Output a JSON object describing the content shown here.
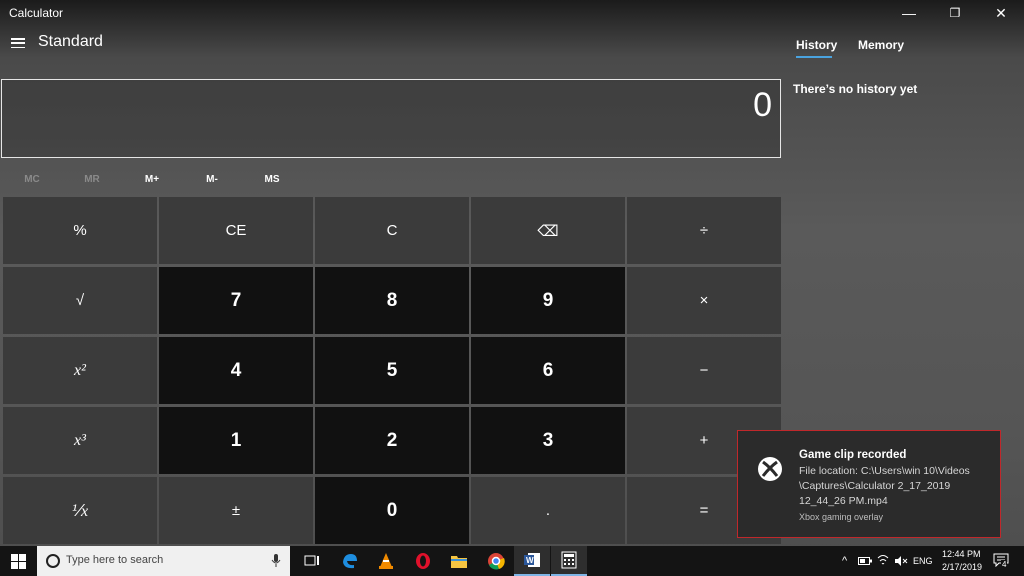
{
  "window": {
    "title": "Calculator",
    "controls": {
      "minimize": "—",
      "maximize": "❐",
      "close": "✕"
    }
  },
  "calculator": {
    "mode": "Standard",
    "display": "0",
    "memory": [
      {
        "label": "MC",
        "enabled": false
      },
      {
        "label": "MR",
        "enabled": false
      },
      {
        "label": "M+",
        "enabled": true
      },
      {
        "label": "M-",
        "enabled": true
      },
      {
        "label": "MS",
        "enabled": true
      }
    ],
    "keys": [
      {
        "label": "%",
        "kind": "op",
        "name": "percent-key"
      },
      {
        "label": "CE",
        "kind": "op",
        "name": "clear-entry-key"
      },
      {
        "label": "C",
        "kind": "op",
        "name": "clear-key"
      },
      {
        "label": "⌫",
        "kind": "op",
        "name": "backspace-key"
      },
      {
        "label": "÷",
        "kind": "op",
        "name": "divide-key"
      },
      {
        "label": "√",
        "kind": "op",
        "name": "square-root-key"
      },
      {
        "label": "7",
        "kind": "digit",
        "name": "digit-7-key"
      },
      {
        "label": "8",
        "kind": "digit",
        "name": "digit-8-key"
      },
      {
        "label": "9",
        "kind": "digit",
        "name": "digit-9-key"
      },
      {
        "label": "×",
        "kind": "op",
        "name": "multiply-key"
      },
      {
        "label": "x²",
        "kind": "italic",
        "name": "square-key"
      },
      {
        "label": "4",
        "kind": "digit",
        "name": "digit-4-key"
      },
      {
        "label": "5",
        "kind": "digit",
        "name": "digit-5-key"
      },
      {
        "label": "6",
        "kind": "digit",
        "name": "digit-6-key"
      },
      {
        "label": "−",
        "kind": "op",
        "name": "subtract-key"
      },
      {
        "label": "x³",
        "kind": "italic",
        "name": "cube-key"
      },
      {
        "label": "1",
        "kind": "digit",
        "name": "digit-1-key"
      },
      {
        "label": "2",
        "kind": "digit",
        "name": "digit-2-key"
      },
      {
        "label": "3",
        "kind": "digit",
        "name": "digit-3-key"
      },
      {
        "label": "+",
        "kind": "op",
        "name": "add-key"
      },
      {
        "label": "⅟x",
        "kind": "italic",
        "name": "reciprocal-key"
      },
      {
        "label": "±",
        "kind": "op",
        "name": "negate-key"
      },
      {
        "label": "0",
        "kind": "digit",
        "name": "digit-0-key"
      },
      {
        "label": ".",
        "kind": "op",
        "name": "decimal-key"
      },
      {
        "label": "=",
        "kind": "op",
        "name": "equals-key"
      }
    ]
  },
  "side_panel": {
    "tabs": [
      "History",
      "Memory"
    ],
    "active_tab": "History",
    "empty_message": "There’s no history yet",
    "accent": "#4aa3df"
  },
  "notification": {
    "title": "Game clip recorded",
    "body": "File location: C:\\Users\\win 10\\Videos \\Captures\\Calculator 2_17_2019 12_44_26 PM.mp4",
    "source": "Xbox gaming overlay",
    "icon": "xbox-icon",
    "border_color": "#c0282b"
  },
  "taskbar": {
    "search_placeholder": "Type here to search",
    "apps": [
      "task-view-icon",
      "edge-icon",
      "vlc-icon",
      "opera-icon",
      "file-explorer-icon",
      "chrome-icon",
      "word-icon",
      "calculator-icon"
    ],
    "language": "ENG",
    "time": "12:44 PM",
    "date": "2/17/2019",
    "notification_count": "4"
  }
}
